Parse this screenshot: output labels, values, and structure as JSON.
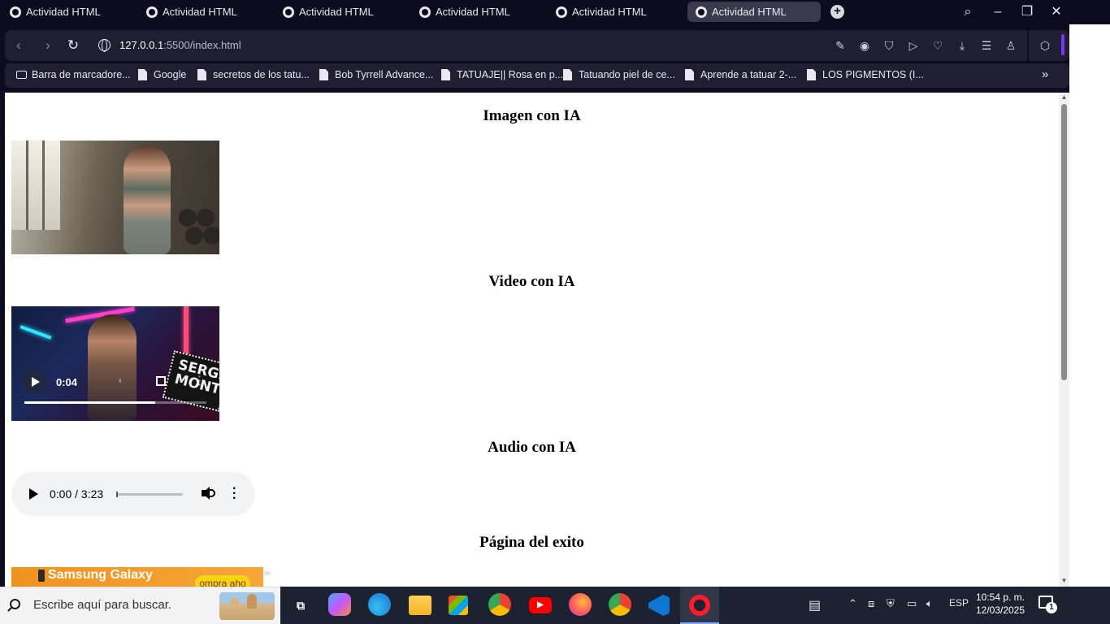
{
  "browser": {
    "tabs": [
      {
        "title": "Actividad HTML",
        "active": false
      },
      {
        "title": "Actividad HTML",
        "active": false
      },
      {
        "title": "Actividad HTML",
        "active": false
      },
      {
        "title": "Actividad HTML",
        "active": false
      },
      {
        "title": "Actividad HTML",
        "active": false
      },
      {
        "title": "Actividad HTML",
        "active": true
      }
    ],
    "url_host": "127.0.0.1",
    "url_rest": ":5500/index.html",
    "accent_color": "#7a35ff"
  },
  "bookmarks": [
    {
      "label": "Barra de marcadore...",
      "icon": "folder-icon"
    },
    {
      "label": "Google",
      "icon": "file-icon"
    },
    {
      "label": "secretos de los tatu...",
      "icon": "file-icon"
    },
    {
      "label": "Bob Tyrrell Advance...",
      "icon": "file-icon"
    },
    {
      "label": "TATUAJE|| Rosa en p...",
      "icon": "file-icon"
    },
    {
      "label": "Tatuando piel de ce...",
      "icon": "file-icon"
    },
    {
      "label": "Aprende a tatuar 2-...",
      "icon": "file-icon"
    },
    {
      "label": "LOS PIGMENTOS (I...",
      "icon": "file-icon"
    }
  ],
  "page": {
    "image_heading": "Imagen con IA",
    "video_heading": "Video con IA",
    "audio_heading": "Audio con IA",
    "exito_heading": "Página del exito",
    "video": {
      "time": "0:04",
      "progress": 0.72,
      "overlay_text": "SERGIO MONTOYA"
    },
    "audio": {
      "time": "0:00 / 3:23",
      "progress": 0.0
    },
    "banner": {
      "title": "Samsung Galaxy",
      "cta": "ompra aho"
    }
  },
  "taskbar": {
    "search_placeholder": "Escribe aquí para buscar.",
    "language": "ESP",
    "time": "10:54 p. m.",
    "date": "12/03/2025",
    "notifications": "1",
    "apps": [
      "task-view-icon",
      "copilot-icon",
      "edge-icon",
      "file-explorer-icon",
      "store-icon",
      "chrome-icon",
      "youtube-icon",
      "firefox-icon",
      "chrome-profile-icon",
      "vscode-icon",
      "opera-icon"
    ]
  }
}
